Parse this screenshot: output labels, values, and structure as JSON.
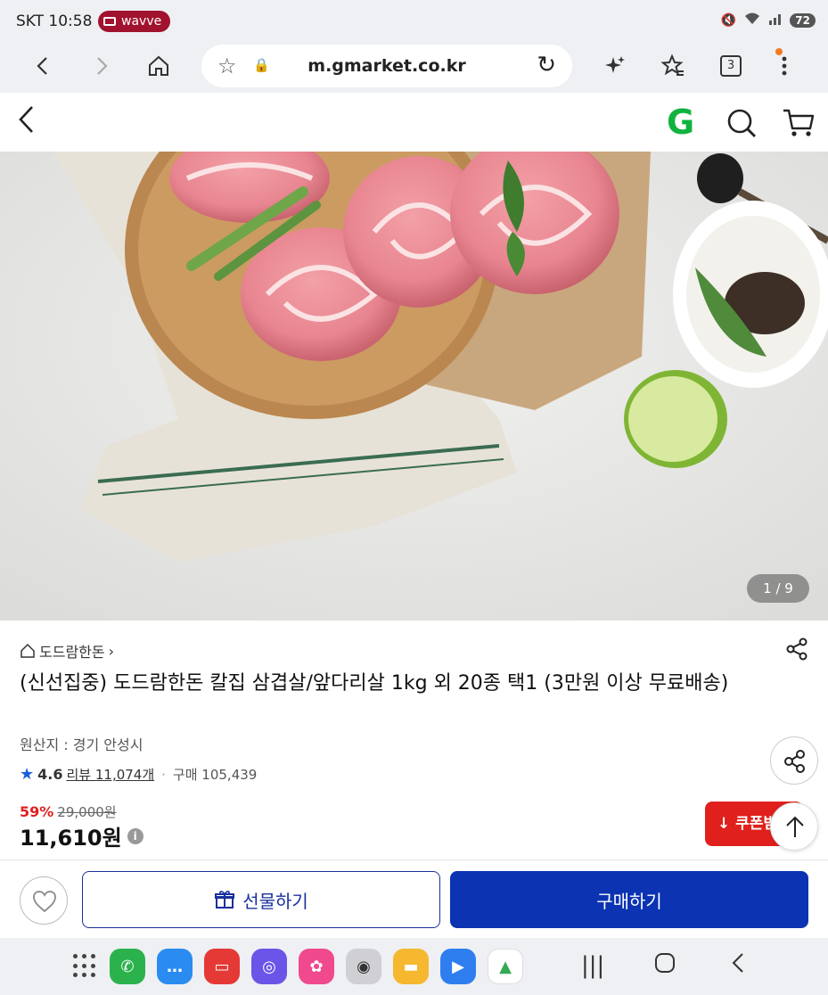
{
  "status_bar": {
    "carrier_time": "SKT 10:58",
    "wavve_label": "wavve",
    "battery": "72"
  },
  "browser": {
    "url": "m.gmarket.co.kr",
    "tab_count": "3"
  },
  "header": {
    "logo": "G"
  },
  "gallery": {
    "pager": "1 / 9"
  },
  "product": {
    "seller": "도드람한돈",
    "title": "(신선집중) 도드람한돈 칼집 삼겹살/앞다리살 1kg 외 20종 택1 (3만원 이상 무료배송)",
    "origin": "원산지 : 경기 안성시",
    "rating": "4.6",
    "reviews": "리뷰 11,074개",
    "purchases": "구매 105,439",
    "discount": "59%",
    "original_price": "29,000원",
    "price": "11,610원",
    "coupon": "쿠폰받"
  },
  "actions": {
    "gift": "선물하기",
    "buy": "구매하기"
  },
  "colors": {
    "brand_green": "#10b33f",
    "buy_blue": "#0b33b2",
    "sale_red": "#e02020"
  }
}
